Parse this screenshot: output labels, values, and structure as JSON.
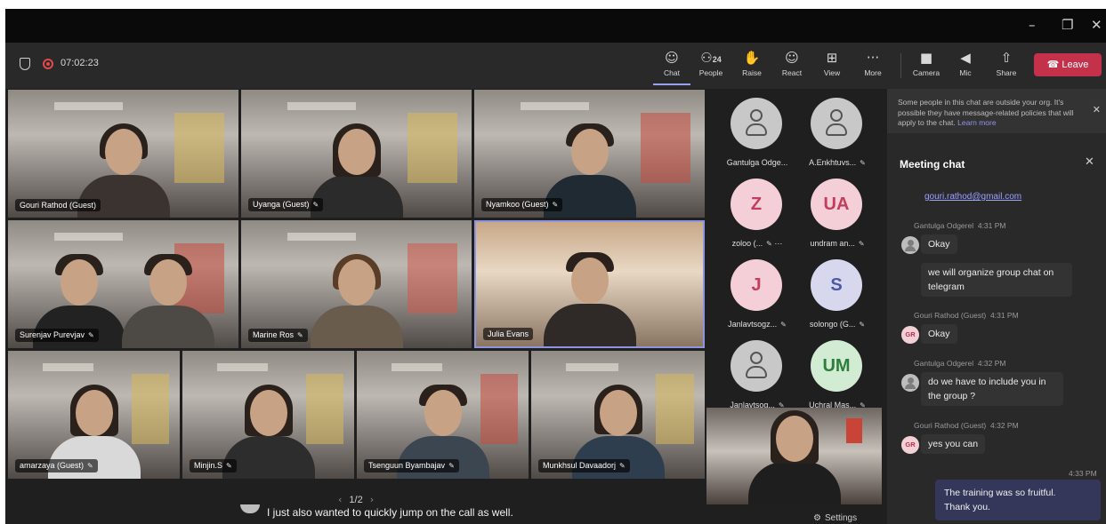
{
  "meeting": {
    "timer": "07:02:23"
  },
  "window_controls": {
    "minimize": "–",
    "maximize": "❐",
    "close": "✕"
  },
  "toolbar": {
    "buttons": [
      {
        "label": "Chat",
        "icon": "chat-icon",
        "glyph": "☺"
      },
      {
        "label": "People",
        "icon": "people-icon",
        "glyph": "⚇",
        "badge": "24"
      },
      {
        "label": "Raise",
        "icon": "raise-hand-icon",
        "glyph": "✋"
      },
      {
        "label": "React",
        "icon": "react-icon",
        "glyph": "☺"
      },
      {
        "label": "View",
        "icon": "view-icon",
        "glyph": "⊞"
      },
      {
        "label": "More",
        "icon": "more-icon",
        "glyph": "···"
      },
      {
        "label": "Camera",
        "icon": "camera-icon",
        "glyph": "■"
      },
      {
        "label": "Mic",
        "icon": "mic-muted-icon",
        "glyph": "◀"
      },
      {
        "label": "Share",
        "icon": "share-icon",
        "glyph": "⇧"
      }
    ],
    "leave_label": "Leave",
    "leave_color": "#c4314b"
  },
  "video_tiles": [
    {
      "name": "Gouri Rathod (Guest)",
      "muted": false
    },
    {
      "name": "Uyanga (Guest)",
      "muted": true
    },
    {
      "name": "Nyamkoo (Guest)",
      "muted": true
    },
    {
      "name": "Surenjav Purevjav",
      "muted": true
    },
    {
      "name": "Marine Ros",
      "muted": true
    },
    {
      "name": "Julia Evans",
      "muted": false
    },
    {
      "name": "amarzaya (Guest)",
      "muted": true
    },
    {
      "name": "Minjin.S",
      "muted": true
    },
    {
      "name": "Tsenguun Byambajav",
      "muted": true
    },
    {
      "name": "Munkhsul Davaadorj",
      "muted": true
    }
  ],
  "pager": {
    "label": "1/2",
    "prev": "‹",
    "next": "›"
  },
  "caption": {
    "text": "I just also wanted to quickly jump on the call as well."
  },
  "roster": [
    {
      "initials": "",
      "name": "Gantulga Odge...",
      "avatar": "gray"
    },
    {
      "initials": "",
      "name": "A.Enkhtuvs...",
      "avatar": "gray"
    },
    {
      "initials": "Z",
      "name": "zoloo (...",
      "avatar": "pink",
      "more": "···"
    },
    {
      "initials": "UA",
      "name": "undram an...",
      "avatar": "pink"
    },
    {
      "initials": "J",
      "name": "Janlavtsogz...",
      "avatar": "pink"
    },
    {
      "initials": "S",
      "name": "solongo (G...",
      "avatar": "lav"
    },
    {
      "initials": "",
      "name": "Janlavtsog...",
      "avatar": "gray"
    },
    {
      "initials": "UM",
      "name": "Uchral Mas...",
      "avatar": "mint"
    }
  ],
  "settings_label": "Settings",
  "chat": {
    "banner_text": "Some people in this chat are outside your org. It's possible they have message-related policies that will apply to the chat.",
    "banner_link": "Learn more",
    "title": "Meeting chat",
    "link_text": "gouri.rathod@gmail.com",
    "messages": [
      {
        "sender": "Gantulga Odgerel",
        "time": "4:31 PM",
        "lines": [
          "Okay"
        ],
        "avatar": "gray",
        "initials": ""
      },
      {
        "sender": "",
        "time": "",
        "lines": [
          "we will organize group chat on",
          "telegram"
        ],
        "avatar": "none",
        "initials": ""
      },
      {
        "sender": "Gouri Rathod (Guest)",
        "time": "4:31 PM",
        "lines": [
          "Okay"
        ],
        "avatar": "gr",
        "initials": "GR"
      },
      {
        "sender": "Gantulga Odgerel",
        "time": "4:32 PM",
        "lines": [
          "do we have to include you in",
          "the group ?"
        ],
        "avatar": "gray",
        "initials": ""
      },
      {
        "sender": "Gouri Rathod (Guest)",
        "time": "4:32 PM",
        "lines": [
          "yes you can"
        ],
        "avatar": "gr",
        "initials": "GR"
      }
    ],
    "my_message": {
      "time": "4:33 PM",
      "lines": [
        "The training was so fruitful.",
        "Thank you."
      ]
    }
  }
}
